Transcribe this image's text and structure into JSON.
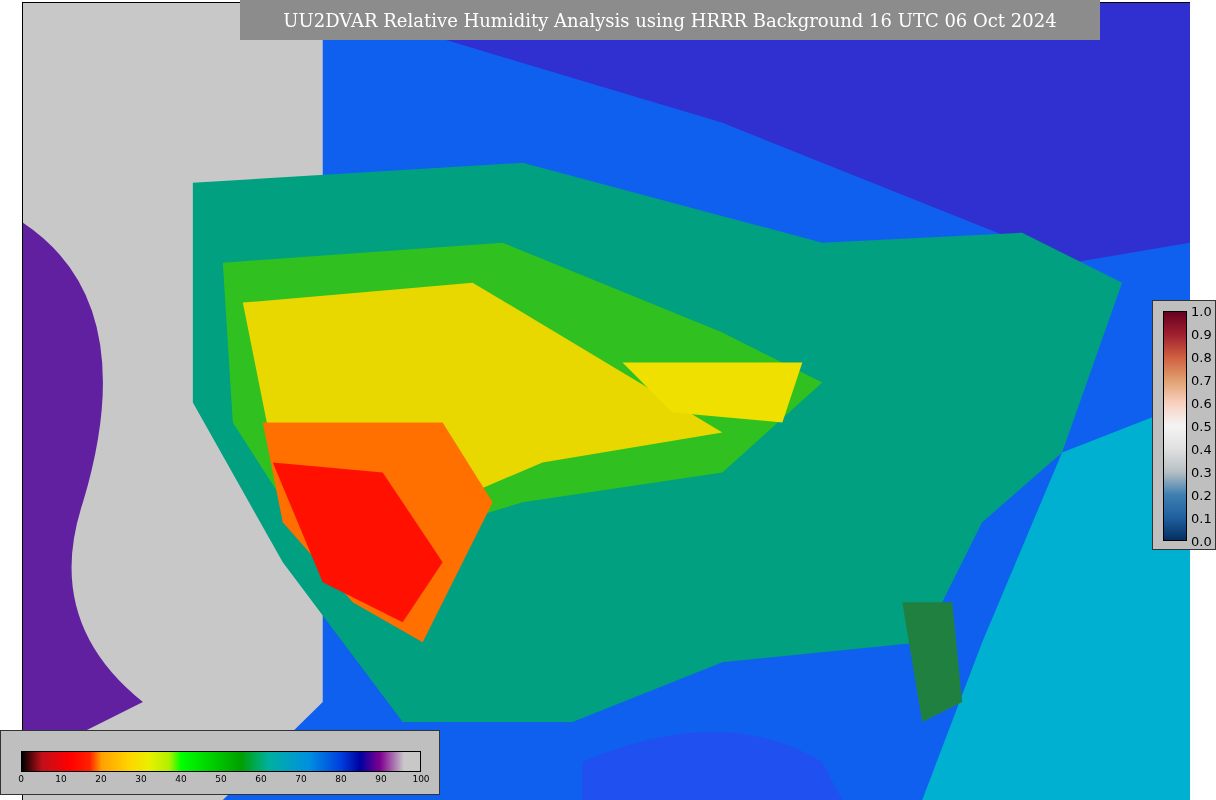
{
  "title": "UU2DVAR Relative Humidity Analysis using HRRR Background 16 UTC 06 Oct 2024",
  "humidity_colorbar": {
    "ticks": [
      "0",
      "10",
      "20",
      "30",
      "40",
      "50",
      "60",
      "70",
      "80",
      "90",
      "100"
    ]
  },
  "station_colorbar": {
    "ticks": [
      "1.0",
      "0.9",
      "0.8",
      "0.7",
      "0.6",
      "0.5",
      "0.4",
      "0.3",
      "0.2",
      "0.1",
      "0.0"
    ]
  }
}
